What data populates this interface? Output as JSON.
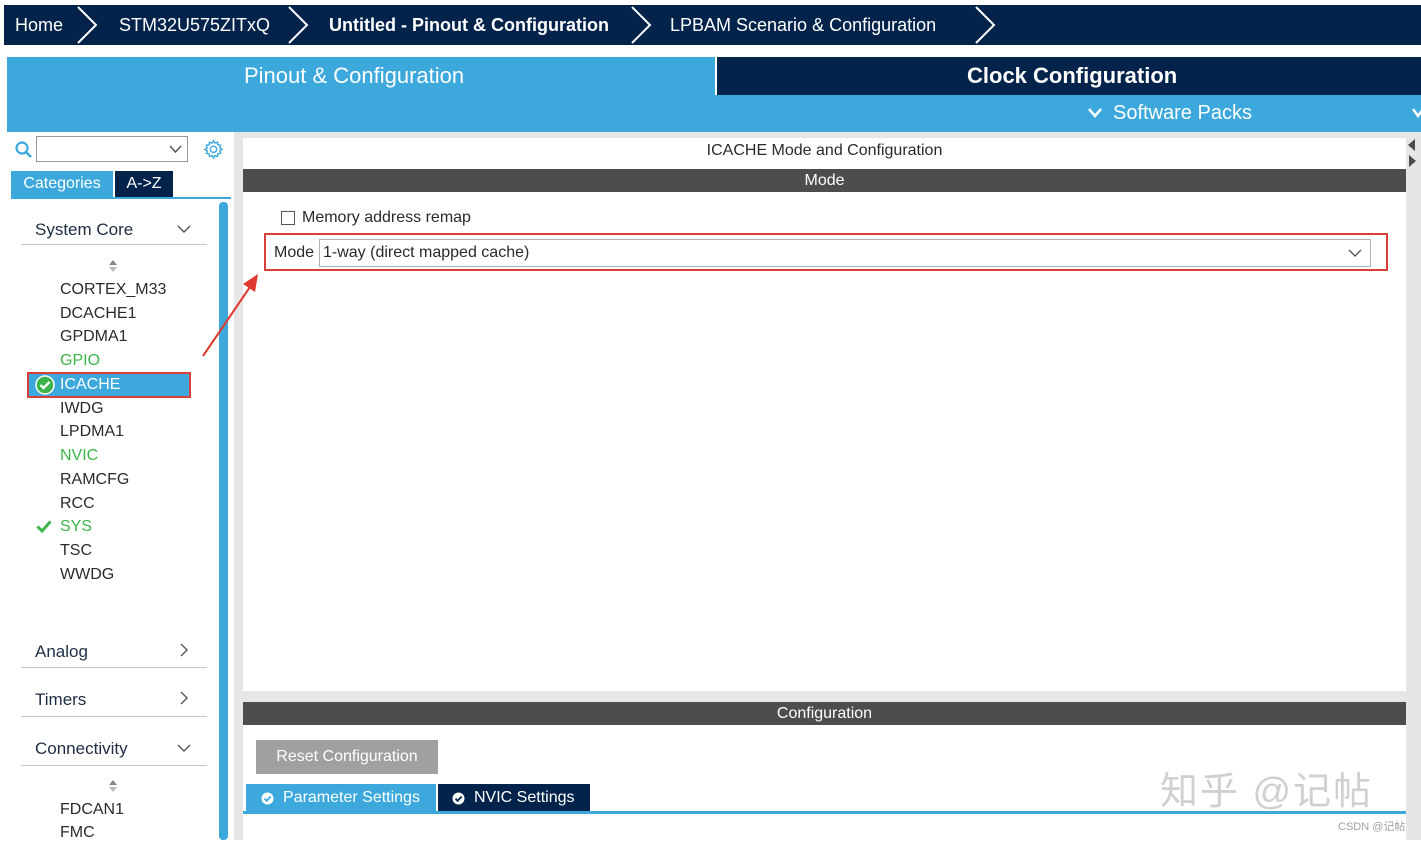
{
  "breadcrumb": {
    "home": "Home",
    "device": "STM32U575ZITxQ",
    "project": "Untitled - Pinout & Configuration",
    "lpbam": "LPBAM Scenario & Configuration"
  },
  "tabs": {
    "pinout": "Pinout & Configuration",
    "clock": "Clock Configuration",
    "software_packs": "Software Packs"
  },
  "left_panel": {
    "search_value": "",
    "tab_categories": "Categories",
    "tab_az": "A->Z",
    "system_core": {
      "label": "System Core",
      "items": [
        {
          "label": "CORTEX_M33",
          "state": "normal"
        },
        {
          "label": "DCACHE1",
          "state": "normal"
        },
        {
          "label": "GPDMA1",
          "state": "normal"
        },
        {
          "label": "GPIO",
          "state": "green"
        },
        {
          "label": "ICACHE",
          "state": "selected"
        },
        {
          "label": "IWDG",
          "state": "normal"
        },
        {
          "label": "LPDMA1",
          "state": "normal"
        },
        {
          "label": "NVIC",
          "state": "green"
        },
        {
          "label": "RAMCFG",
          "state": "normal"
        },
        {
          "label": "RCC",
          "state": "normal"
        },
        {
          "label": "SYS",
          "state": "checked"
        },
        {
          "label": "TSC",
          "state": "normal"
        },
        {
          "label": "WWDG",
          "state": "normal"
        }
      ]
    },
    "analog": "Analog",
    "timers": "Timers",
    "connectivity": {
      "label": "Connectivity",
      "items": [
        "FDCAN1",
        "FMC"
      ]
    }
  },
  "mode_panel": {
    "title": "ICACHE Mode and Configuration",
    "header": "Mode",
    "remap_label": "Memory address remap",
    "mode_label": "Mode",
    "mode_value": "1-way (direct mapped cache)"
  },
  "config_panel": {
    "header": "Configuration",
    "reset_button": "Reset Configuration",
    "tab_parameter": "Parameter Settings",
    "tab_nvic": "NVIC Settings"
  },
  "watermark": {
    "zhihu": "知乎 @记帖",
    "csdn": "CSDN @记帖"
  },
  "colors": {
    "navy": "#03234b",
    "blue": "#3ca8dc",
    "green": "#3cb44b",
    "highlight_red": "#d9403a"
  }
}
